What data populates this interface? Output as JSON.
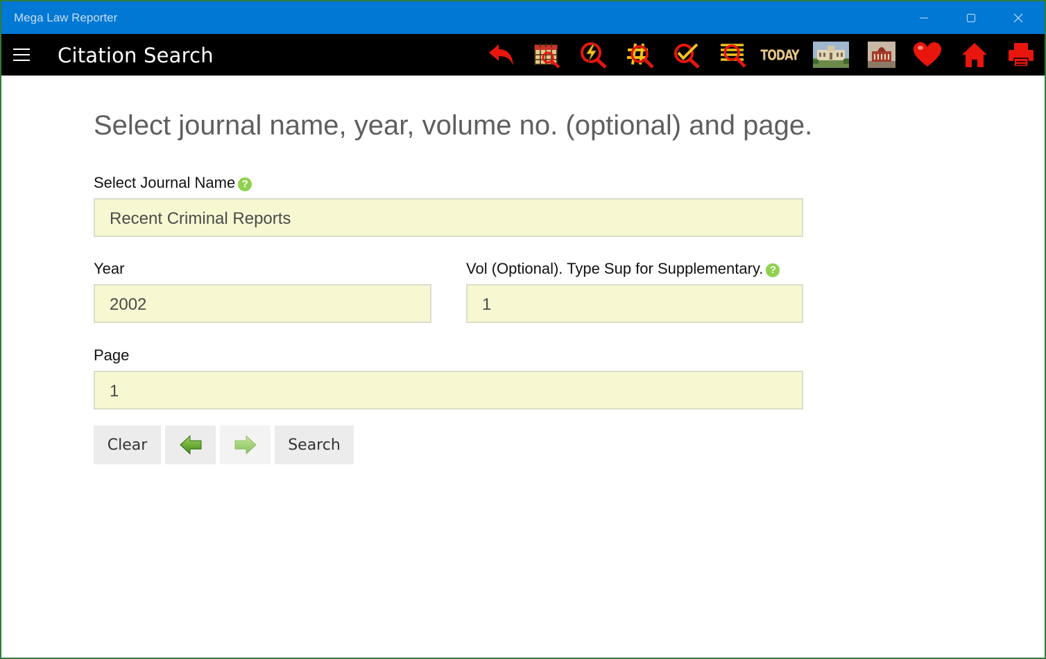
{
  "window": {
    "title": "Mega Law Reporter"
  },
  "toolbar": {
    "page_title": "Citation Search",
    "icons": [
      {
        "name": "back-icon",
        "color": "#e8160c"
      },
      {
        "name": "calendar-search-icon",
        "color": "#e8160c"
      },
      {
        "name": "lightning-search-icon",
        "color": "#e8160c"
      },
      {
        "name": "hash-search-icon",
        "color": "#e8160c"
      },
      {
        "name": "check-search-icon",
        "color": "#e8160c"
      },
      {
        "name": "list-search-icon",
        "color": "#e8160c"
      },
      {
        "name": "today-icon",
        "label": "TODAY",
        "color": "#e7c58a"
      },
      {
        "name": "high-court-photo-icon"
      },
      {
        "name": "supreme-court-photo-icon"
      },
      {
        "name": "favorites-heart-icon",
        "color": "#e8160c"
      },
      {
        "name": "home-icon",
        "color": "#e8160c"
      },
      {
        "name": "print-icon",
        "color": "#e8160c"
      }
    ]
  },
  "form": {
    "instruction": "Select journal name, year, volume no. (optional) and page.",
    "journal": {
      "label": "Select Journal Name",
      "value": "Recent Criminal Reports"
    },
    "year": {
      "label": "Year",
      "value": "2002"
    },
    "volume": {
      "label": "Vol (Optional). Type Sup for Supplementary.",
      "value": "1"
    },
    "page": {
      "label": "Page",
      "value": "1"
    },
    "help_glyph": "?"
  },
  "buttons": {
    "clear": "Clear",
    "search": "Search",
    "prev_enabled": true,
    "next_enabled": false
  },
  "colors": {
    "titlebar": "#0078d4",
    "toolbar": "#000000",
    "field_background": "#f7f8d2",
    "accent_red": "#e8160c",
    "help_green": "#8fd14f"
  }
}
